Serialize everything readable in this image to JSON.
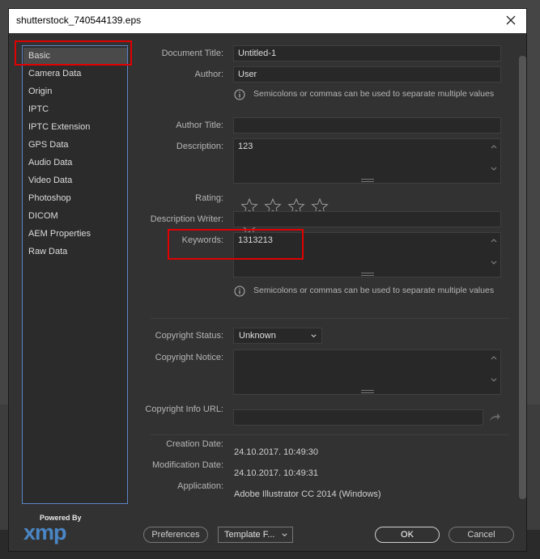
{
  "window": {
    "title": "shutterstock_740544139.eps"
  },
  "sidebar": {
    "items": [
      {
        "label": "Basic"
      },
      {
        "label": "Camera Data"
      },
      {
        "label": "Origin"
      },
      {
        "label": "IPTC"
      },
      {
        "label": "IPTC Extension"
      },
      {
        "label": "GPS Data"
      },
      {
        "label": "Audio Data"
      },
      {
        "label": "Video Data"
      },
      {
        "label": "Photoshop"
      },
      {
        "label": "DICOM"
      },
      {
        "label": "AEM Properties"
      },
      {
        "label": "Raw Data"
      }
    ],
    "selected": "Basic"
  },
  "branding": {
    "powered_by": "Powered By",
    "logo_text": "xmp"
  },
  "form": {
    "document_title": {
      "label": "Document Title:",
      "value": "Untitled-1"
    },
    "author": {
      "label": "Author:",
      "value": "User"
    },
    "author_hint": "Semicolons or commas can be used to separate multiple values",
    "author_title": {
      "label": "Author Title:",
      "value": ""
    },
    "description": {
      "label": "Description:",
      "value": "123"
    },
    "rating": {
      "label": "Rating:",
      "stars": 0,
      "max": 5
    },
    "description_writer": {
      "label": "Description Writer:",
      "value": ""
    },
    "keywords": {
      "label": "Keywords:",
      "value": "1313213"
    },
    "keywords_hint": "Semicolons or commas can be used to separate multiple values",
    "copyright_status": {
      "label": "Copyright Status:",
      "value": "Unknown"
    },
    "copyright_notice": {
      "label": "Copyright Notice:",
      "value": ""
    },
    "copyright_url": {
      "label": "Copyright Info URL:",
      "value": ""
    },
    "creation_date": {
      "label": "Creation Date:",
      "value": "24.10.2017. 10:49:30"
    },
    "modification_date": {
      "label": "Modification Date:",
      "value": "24.10.2017. 10:49:31"
    },
    "application": {
      "label": "Application:",
      "value": "Adobe Illustrator CC 2014 (Windows)"
    }
  },
  "footer": {
    "preferences": "Preferences",
    "template": "Template F...",
    "ok": "OK",
    "cancel": "Cancel"
  },
  "colors": {
    "highlight": "#e00000",
    "sidebar_border": "#5b86c8",
    "xmp_blue": "#4a86c5"
  }
}
